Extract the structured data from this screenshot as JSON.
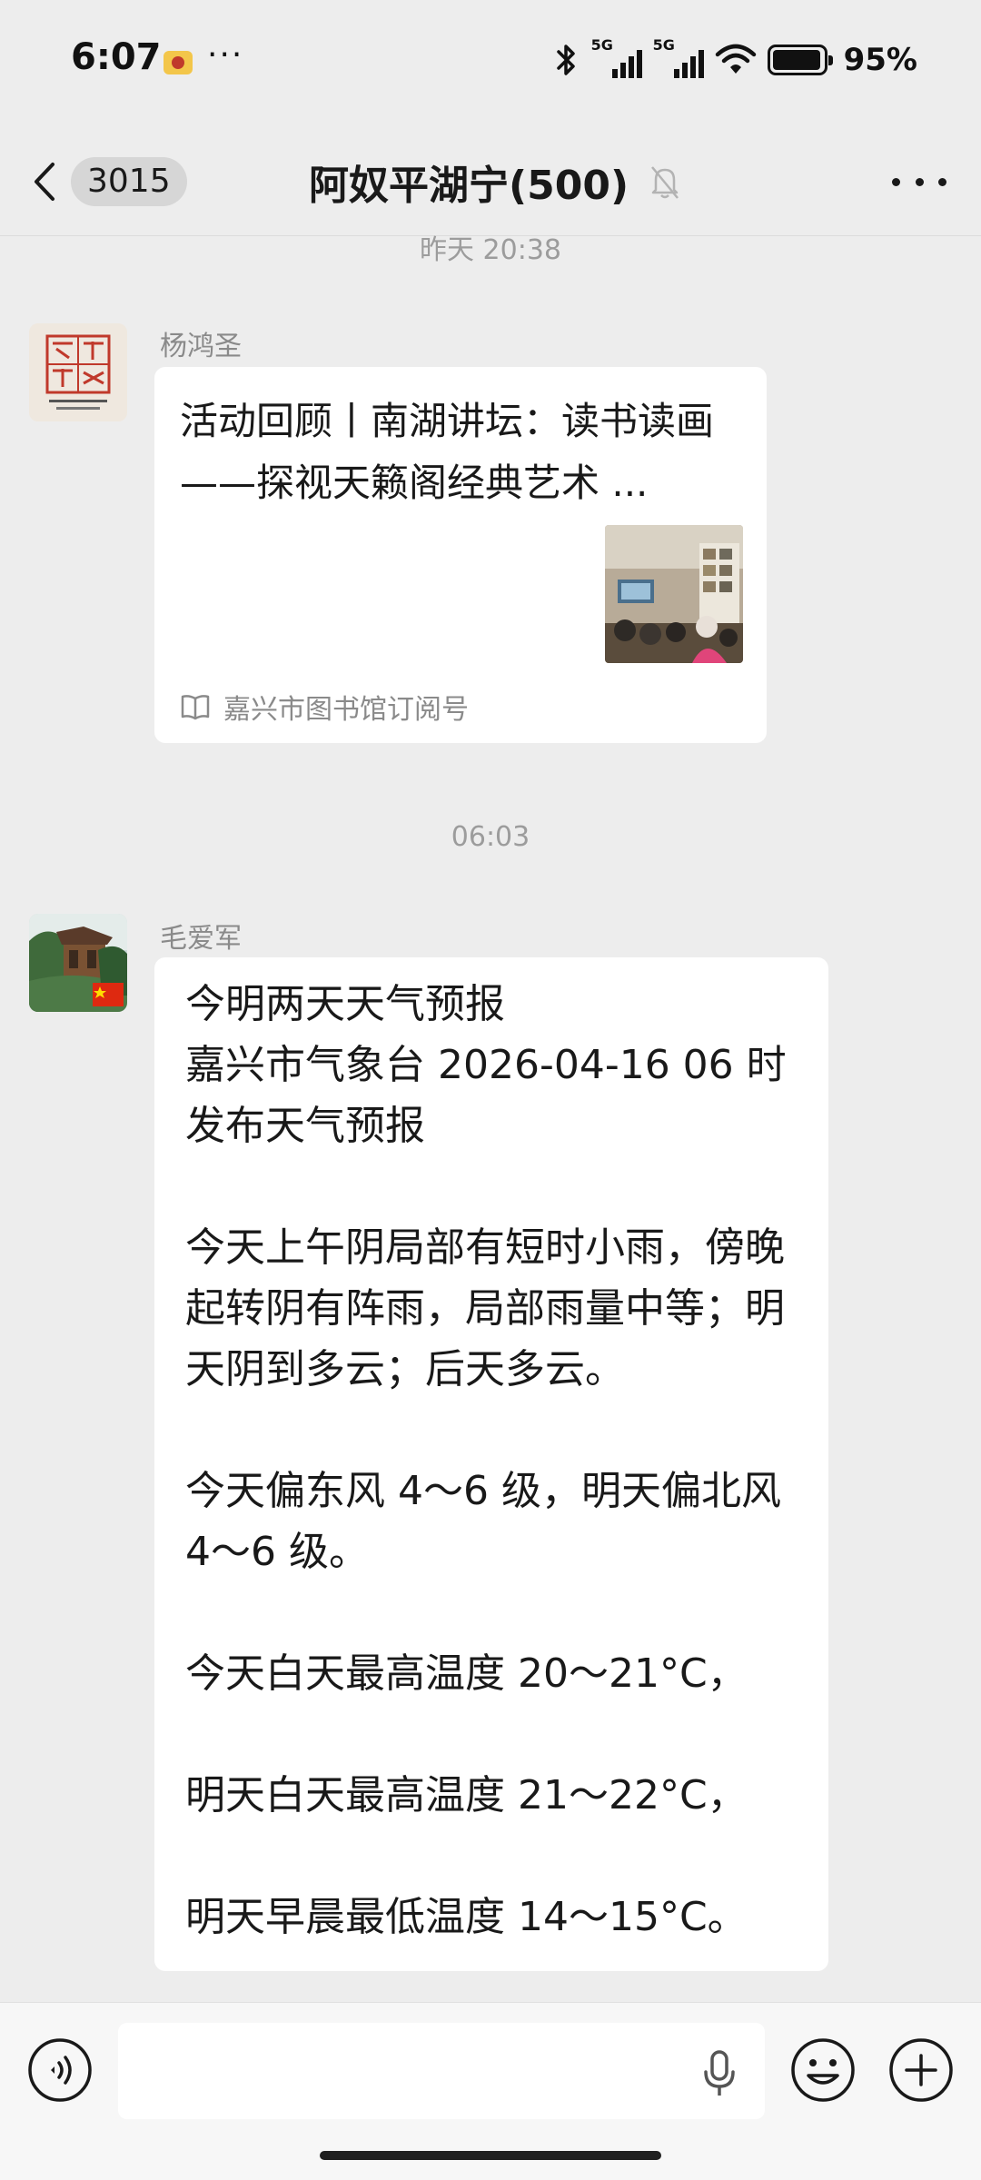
{
  "status_bar": {
    "time": "6:07",
    "more": "···",
    "signal1_label": "5G",
    "signal2_label": "5G",
    "battery": "95%"
  },
  "header": {
    "unread_count": "3015",
    "title": "阿奴平湖宁(500)"
  },
  "messages": [
    {
      "timestamp": "昨天 20:38",
      "sender": "杨鸿圣",
      "type": "article",
      "title": "活动回顾丨南湖讲坛：读书读画——探视天籁阁经典艺术 ...",
      "source": "嘉兴市图书馆订阅号"
    },
    {
      "timestamp": "06:03",
      "sender": "毛爱军",
      "type": "text",
      "paragraphs": [
        "今明两天天气预报",
        "嘉兴市气象台 2026-04-16 06 时发布天气预报",
        "",
        "今天上午阴局部有短时小雨，傍晚起转阴有阵雨，局部雨量中等；明天阴到多云；后天多云。",
        "",
        "今天偏东风 4～6 级，明天偏北风 4～6 级。",
        "",
        "今天白天最高温度 20～21°C，",
        "",
        "明天白天最高温度 21～22°C，",
        "",
        "明天早晨最低温度 14～15°C。"
      ]
    }
  ],
  "input": {
    "placeholder": ""
  },
  "icons": {
    "back": "chevron-left-icon",
    "mute": "bell-off-icon",
    "more": "more-icon",
    "voice": "voice-icon",
    "mic": "mic-icon",
    "emoji": "emoji-icon",
    "plus": "plus-icon",
    "book": "book-icon"
  }
}
